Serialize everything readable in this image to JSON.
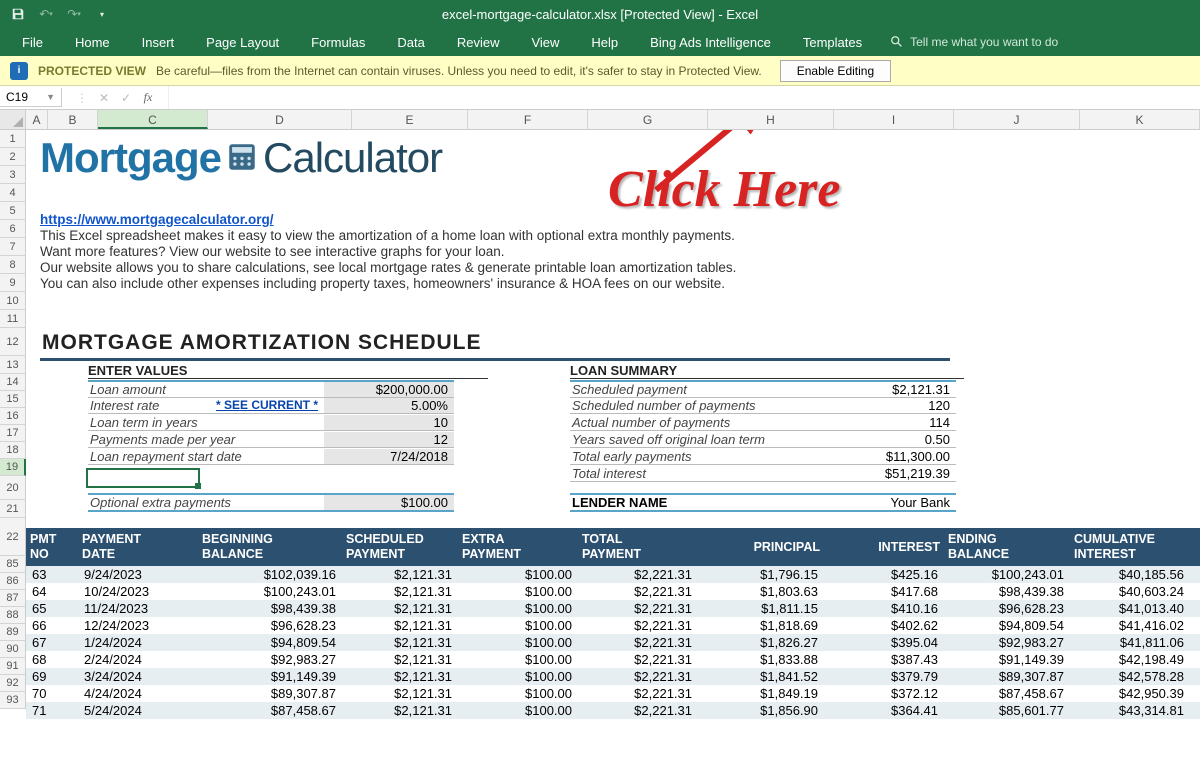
{
  "window": {
    "title": "excel-mortgage-calculator.xlsx  [Protected View]  -  Excel"
  },
  "ribbon": {
    "tabs": [
      "File",
      "Home",
      "Insert",
      "Page Layout",
      "Formulas",
      "Data",
      "Review",
      "View",
      "Help",
      "Bing Ads Intelligence",
      "Templates"
    ],
    "tellme_placeholder": "Tell me what you want to do"
  },
  "protected_view": {
    "label": "PROTECTED VIEW",
    "message": "Be careful—files from the Internet can contain viruses. Unless you need to edit, it's safer to stay in Protected View.",
    "button": "Enable Editing"
  },
  "namebox": "C19",
  "columns": [
    "A",
    "B",
    "C",
    "D",
    "E",
    "F",
    "G",
    "H",
    "I",
    "J",
    "K"
  ],
  "row_numbers_top": [
    "1",
    "2",
    "3",
    "4",
    "5",
    "6",
    "7",
    "8",
    "9",
    "10",
    "11",
    "12",
    "13",
    "14",
    "15",
    "16",
    "17",
    "18",
    "19",
    "20",
    "21",
    "22"
  ],
  "row_numbers_data": [
    "85",
    "86",
    "87",
    "88",
    "89",
    "90",
    "91",
    "92",
    "93"
  ],
  "logo": {
    "part1": "Mortgage",
    "part2": "Calculator"
  },
  "desc": {
    "link": "https://www.mortgagecalculator.org/",
    "l1": "This Excel spreadsheet makes it easy to view the amortization of a home loan with optional extra monthly payments.",
    "l2": "Want more features? View our website to see interactive graphs for your loan.",
    "l3": "Our website allows you to share calculations, see local mortgage rates & generate printable loan amortization tables.",
    "l4": "You can also include other expenses including property taxes, homeowners' insurance & HOA fees on our website."
  },
  "heading_schedule": "MORTGAGE AMORTIZATION SCHEDULE",
  "enter_values": {
    "title": "ENTER VALUES",
    "rows": [
      {
        "label": "Loan amount",
        "value": "$200,000.00",
        "shaded": true
      },
      {
        "label": "Interest rate",
        "link": "* SEE CURRENT *",
        "value": "5.00%",
        "shaded": true
      },
      {
        "label": "Loan term in years",
        "value": "10",
        "shaded": true
      },
      {
        "label": "Payments made per year",
        "value": "12",
        "shaded": true
      },
      {
        "label": "Loan repayment start date",
        "value": "7/24/2018",
        "shaded": true
      }
    ],
    "extra_label": "Optional extra payments",
    "extra_value": "$100.00"
  },
  "loan_summary": {
    "title": "LOAN SUMMARY",
    "rows": [
      {
        "label": "Scheduled payment",
        "value": "$2,121.31"
      },
      {
        "label": "Scheduled number of payments",
        "value": "120"
      },
      {
        "label": "Actual number of payments",
        "value": "114"
      },
      {
        "label": "Years saved off original loan term",
        "value": "0.50"
      },
      {
        "label": "Total early payments",
        "value": "$11,300.00"
      },
      {
        "label": "Total interest",
        "value": "$51,219.39"
      }
    ],
    "lender_label": "LENDER NAME",
    "lender_value": "Your Bank"
  },
  "table": {
    "headers": [
      "PMT NO",
      "PAYMENT DATE",
      "BEGINNING BALANCE",
      "SCHEDULED PAYMENT",
      "EXTRA PAYMENT",
      "TOTAL PAYMENT",
      "PRINCIPAL",
      "INTEREST",
      "ENDING BALANCE",
      "CUMULATIVE INTEREST"
    ],
    "rows": [
      [
        "63",
        "9/24/2023",
        "$102,039.16",
        "$2,121.31",
        "$100.00",
        "$2,221.31",
        "$1,796.15",
        "$425.16",
        "$100,243.01",
        "$40,185.56"
      ],
      [
        "64",
        "10/24/2023",
        "$100,243.01",
        "$2,121.31",
        "$100.00",
        "$2,221.31",
        "$1,803.63",
        "$417.68",
        "$98,439.38",
        "$40,603.24"
      ],
      [
        "65",
        "11/24/2023",
        "$98,439.38",
        "$2,121.31",
        "$100.00",
        "$2,221.31",
        "$1,811.15",
        "$410.16",
        "$96,628.23",
        "$41,013.40"
      ],
      [
        "66",
        "12/24/2023",
        "$96,628.23",
        "$2,121.31",
        "$100.00",
        "$2,221.31",
        "$1,818.69",
        "$402.62",
        "$94,809.54",
        "$41,416.02"
      ],
      [
        "67",
        "1/24/2024",
        "$94,809.54",
        "$2,121.31",
        "$100.00",
        "$2,221.31",
        "$1,826.27",
        "$395.04",
        "$92,983.27",
        "$41,811.06"
      ],
      [
        "68",
        "2/24/2024",
        "$92,983.27",
        "$2,121.31",
        "$100.00",
        "$2,221.31",
        "$1,833.88",
        "$387.43",
        "$91,149.39",
        "$42,198.49"
      ],
      [
        "69",
        "3/24/2024",
        "$91,149.39",
        "$2,121.31",
        "$100.00",
        "$2,221.31",
        "$1,841.52",
        "$379.79",
        "$89,307.87",
        "$42,578.28"
      ],
      [
        "70",
        "4/24/2024",
        "$89,307.87",
        "$2,121.31",
        "$100.00",
        "$2,221.31",
        "$1,849.19",
        "$372.12",
        "$87,458.67",
        "$42,950.39"
      ],
      [
        "71",
        "5/24/2024",
        "$87,458.67",
        "$2,121.31",
        "$100.00",
        "$2,221.31",
        "$1,856.90",
        "$364.41",
        "$85,601.77",
        "$43,314.81"
      ]
    ]
  },
  "annotation": {
    "text": "Click Here"
  },
  "colwidths": {
    "A": 22,
    "B": 50,
    "C": 110,
    "D": 144,
    "E": 116,
    "F": 120,
    "G": 120,
    "H": 126,
    "I": 120,
    "J": 126,
    "K": 120
  }
}
